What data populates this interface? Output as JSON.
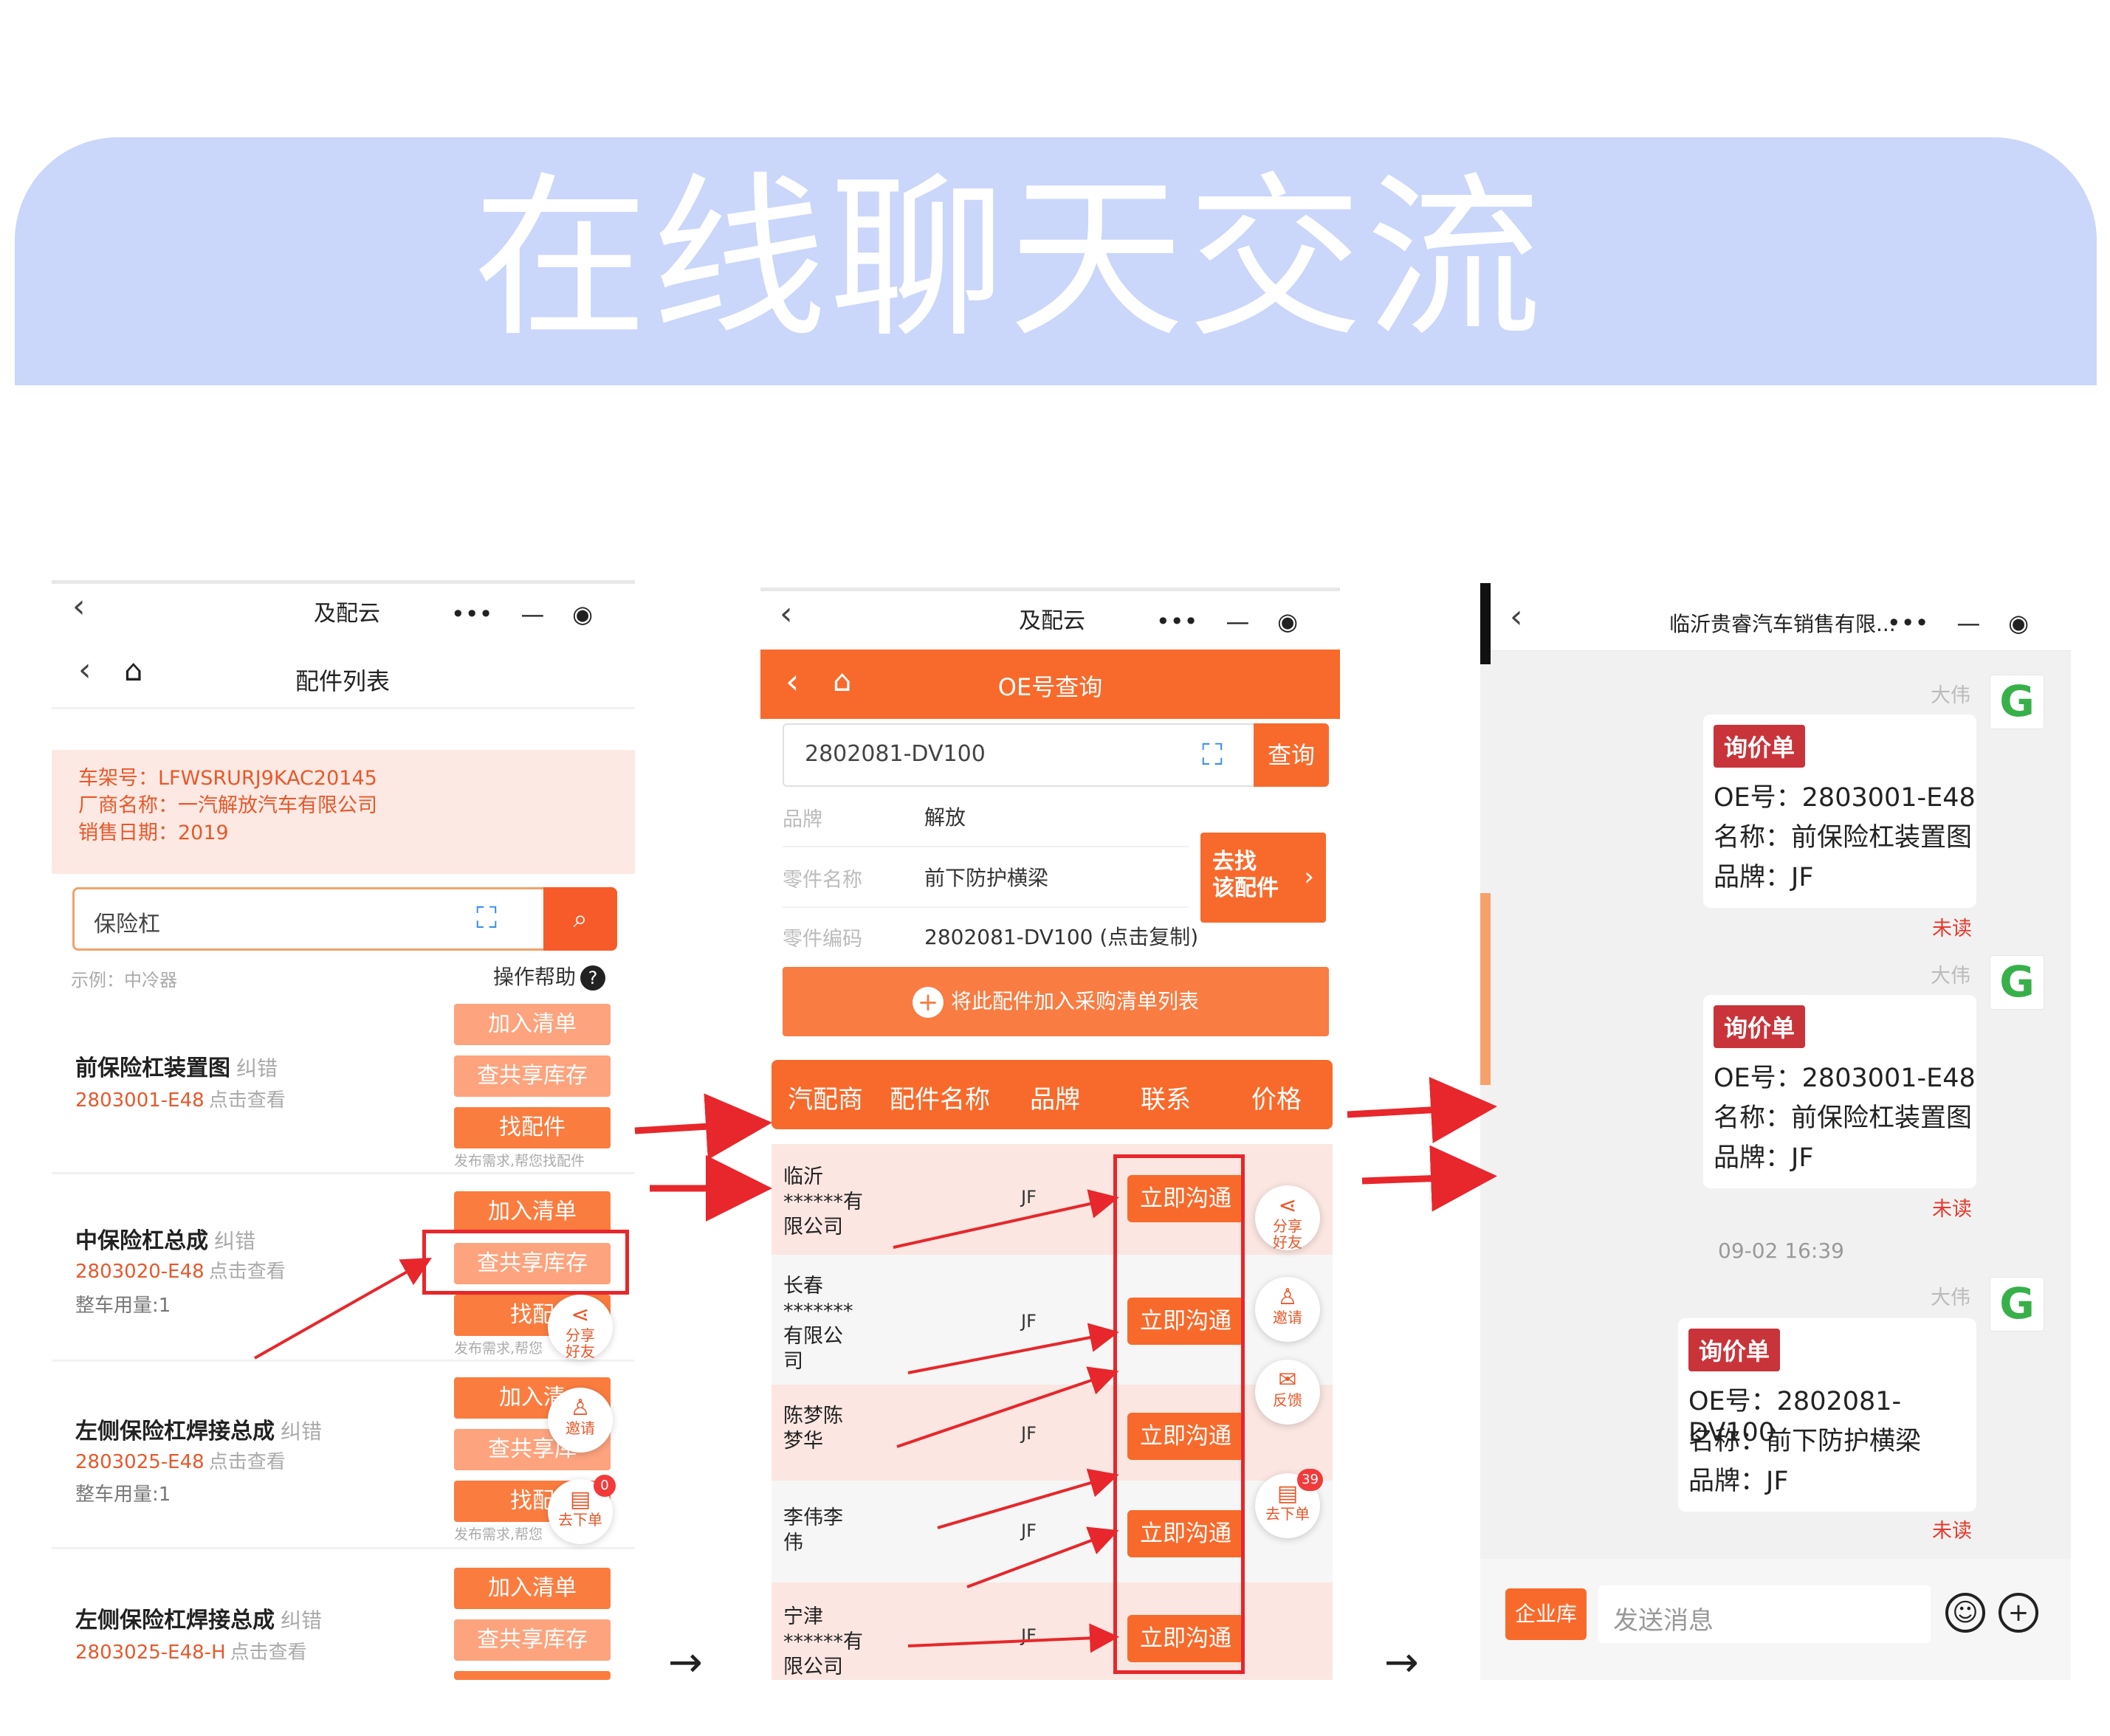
{
  "banner": {
    "title": "在线聊天交流"
  },
  "phone1": {
    "app_title": "及配云",
    "page_title": "配件列表",
    "info": {
      "vin": "车架号：LFWSRURJ9KAC20145",
      "maker": "厂商名称：一汽解放汽车有限公司",
      "sale_date": "销售日期：2019"
    },
    "search": {
      "value": "保险杠"
    },
    "example": "示例：中冷器",
    "help": "操作帮助",
    "help_icon": "?",
    "btn_add": "加入清单",
    "btn_stock": "查共享库存",
    "btn_find": "找配件",
    "btn_find_short": "找配",
    "btn_stock_short": "查共享库存",
    "btn_add_short": "加入清",
    "btn_stock_short2": "查共享库",
    "btn_find_short2": "找配",
    "tip_full": "发布需求,帮您找配件",
    "tip_short": "发布需求,帮您",
    "fix": "纠错",
    "click_view": "点击查看",
    "usage": "整车用量:1",
    "products": [
      {
        "name": "前保险杠装置图",
        "code": "2803001-E48"
      },
      {
        "name": "中保险杠总成",
        "code": "2803020-E48"
      },
      {
        "name": "左侧保险杠焊接总成",
        "code": "2803025-E48"
      },
      {
        "name": "左侧保险杠焊接总成",
        "code": "2803025-E48-H"
      }
    ],
    "fab": {
      "share": "分享好友",
      "invite": "邀请",
      "order": "去下单",
      "order_badge": "0"
    }
  },
  "phone2": {
    "app_title": "及配云",
    "header": "OE号查询",
    "search": {
      "value": "2802081-DV100",
      "button": "查询"
    },
    "fields": [
      {
        "label": "品牌",
        "value": "解放"
      },
      {
        "label": "零件名称",
        "value": "前下防护横梁"
      },
      {
        "label": "零件编码",
        "value": "2802081-DV100 (点击复制)"
      }
    ],
    "go_find": {
      "line1": "去找",
      "line2": "该配件"
    },
    "add_bar": "将此配件加入采购清单列表",
    "table_headers": [
      "汽配商",
      "配件名称",
      "品牌",
      "联系",
      "价格"
    ],
    "chat_label": "立即沟通",
    "rows": [
      {
        "name": "临沂\n******有\n限公司",
        "brand": "JF"
      },
      {
        "name": "长春\n*******\n有限公\n司",
        "brand": "JF"
      },
      {
        "name": "陈梦陈\n梦华",
        "brand": "JF"
      },
      {
        "name": "李伟李\n伟",
        "brand": "JF"
      },
      {
        "name": "宁津\n******有\n限公司",
        "brand": "JF"
      }
    ],
    "fab": {
      "share": "分享好友",
      "invite": "邀请",
      "feedback": "反馈",
      "order": "去下单",
      "order_badge": "39"
    }
  },
  "phone3": {
    "title": "临沂贵睿汽车销售有限...",
    "sender": "大伟",
    "tag": "询价单",
    "unread": "未读",
    "timestamp": "09-02 16:39",
    "messages": [
      {
        "oe": "OE号：2803001-E48",
        "name": "名称：前保险杠装置图",
        "brand": "品牌：JF"
      },
      {
        "oe": "OE号：2803001-E48",
        "name": "名称：前保险杠装置图",
        "brand": "品牌：JF"
      },
      {
        "oe": "OE号：2802081-DV100",
        "name": "名称：前下防护横梁",
        "brand": "品牌：JF"
      }
    ],
    "bottom": {
      "lib_button": "企业库",
      "placeholder": "发送消息"
    }
  },
  "arrow_glyph": "→",
  "colors": {
    "accent": "#f86a2b",
    "highlight": "#e7272b",
    "banner": "#cad6fa"
  }
}
